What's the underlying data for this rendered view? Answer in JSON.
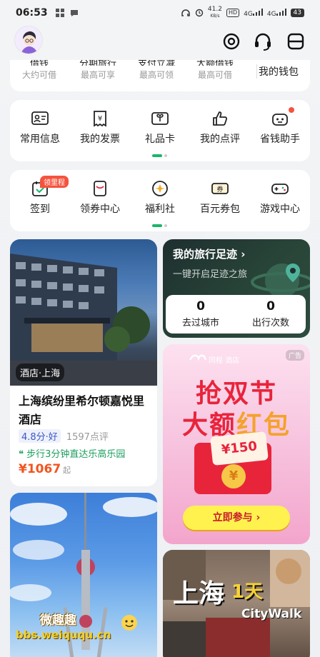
{
  "status_bar": {
    "time": "06:53",
    "net_speed": "41.2",
    "net_unit": "KB/s",
    "hd1": "HD",
    "net1": "4G",
    "net2": "4G",
    "battery": "43"
  },
  "wallet_row": {
    "items": [
      {
        "cut": "借钱",
        "sub": "大约可借"
      },
      {
        "cut": "分期旅行",
        "sub": "最高可享"
      },
      {
        "cut": "支付立减",
        "sub": "最高可领"
      },
      {
        "cut": "大额借钱",
        "sub": "最高可借"
      }
    ],
    "my_wallet": "我的钱包"
  },
  "services_row1": [
    {
      "label": "常用信息",
      "icon": "id-card-icon"
    },
    {
      "label": "我的发票",
      "icon": "invoice-icon"
    },
    {
      "label": "礼品卡",
      "icon": "gift-card-icon"
    },
    {
      "label": "我的点评",
      "icon": "thumbs-up-icon"
    },
    {
      "label": "省钱助手",
      "icon": "assistant-icon"
    }
  ],
  "services_row2": [
    {
      "label": "签到",
      "icon": "checkin-icon"
    },
    {
      "label": "领券中心",
      "icon": "coupon-center-icon"
    },
    {
      "label": "福利社",
      "icon": "welfare-icon"
    },
    {
      "label": "百元券包",
      "icon": "coupon-pack-icon"
    },
    {
      "label": "游戏中心",
      "icon": "gamepad-icon"
    }
  ],
  "checkin_tag": "领里程",
  "hotel_card": {
    "location": "酒店·上海",
    "title": "上海缤纷里希尔顿嘉悦里酒店",
    "score": "4.8分·好",
    "reviews": "1597点评",
    "note": "步行3分钟直达乐高乐园",
    "price": "¥1067",
    "price_suffix": "起"
  },
  "footprint_card": {
    "title": "我的旅行足迹",
    "subtitle": "一键开启足迹之旅",
    "cities_value": "0",
    "cities_label": "去过城市",
    "trips_value": "0",
    "trips_label": "出行次数"
  },
  "ad_card": {
    "brand": "同程·酒店",
    "ad_tag": "广告",
    "line1": "抢双节",
    "line2_a": "大额",
    "line2_b": "红包",
    "coupon": "¥150",
    "coin": "¥",
    "button": "立即参与 ›"
  },
  "walk_card": {
    "city": "上海",
    "days": "1天",
    "citywalk": "CityWalk"
  },
  "watermark": {
    "name": "微趣趣",
    "url": "bbs.weiququ.cn"
  },
  "colors": {
    "accent_green": "#1db46a",
    "price_red": "#f2541f",
    "ad_red": "#e8243b"
  }
}
